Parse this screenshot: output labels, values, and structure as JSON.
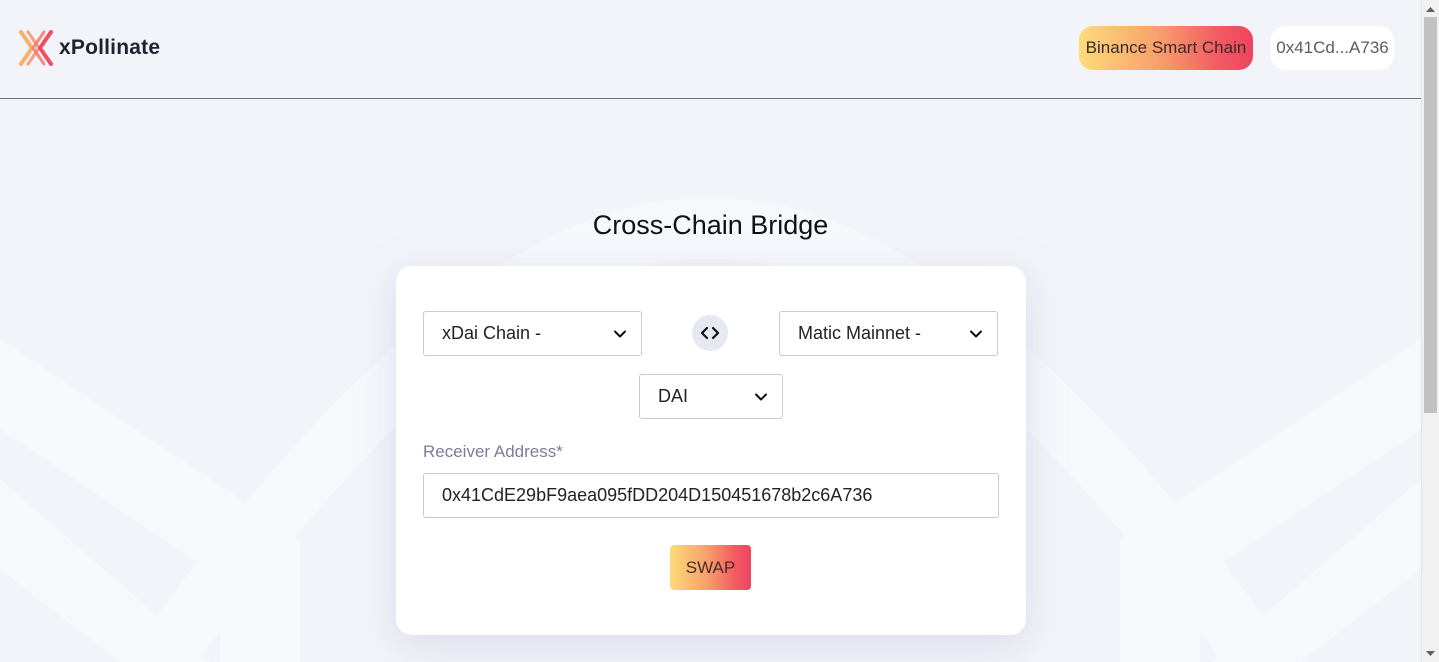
{
  "header": {
    "brand": "xPollinate",
    "network_button": "Binance Smart Chain",
    "wallet_button": "0x41Cd...A736"
  },
  "main": {
    "title": "Cross-Chain Bridge",
    "from_chain": "xDai Chain -",
    "to_chain": "Matic Mainnet -",
    "token": "DAI",
    "receiver_label": "Receiver Address*",
    "receiver_value": "0x41CdE29bF9aea095fDD204D150451678b2c6A736",
    "swap_button": "SWAP"
  },
  "icons": {
    "logo": "xpollinate-logo-icon",
    "swap_direction": "swap-direction-icon",
    "dropdown": "chevron-down-icon"
  },
  "colors": {
    "gradient_start": "#fcdb7a",
    "gradient_end": "#ef4460",
    "background": "#f3f4f9",
    "card": "#ffffff"
  }
}
